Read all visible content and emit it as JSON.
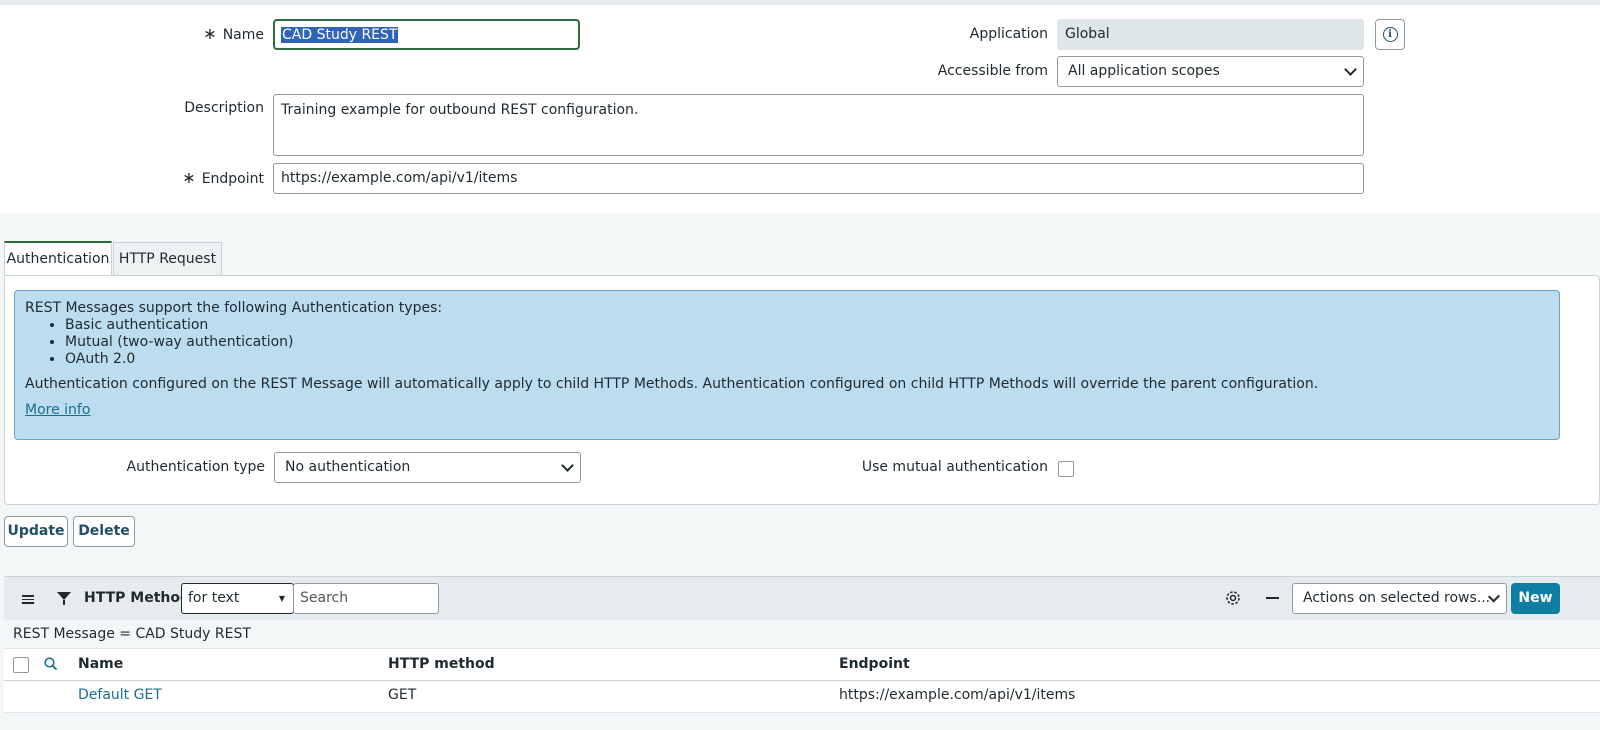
{
  "form": {
    "name_label": "Name",
    "name_value": "CAD Study REST",
    "application_label": "Application",
    "application_value": "Global",
    "accessible_label": "Accessible from",
    "accessible_value": "All application scopes",
    "description_label": "Description",
    "description_value": "Training example for outbound REST configuration.",
    "endpoint_label": "Endpoint",
    "endpoint_value": "https://example.com/api/v1/items",
    "required_mark": "∗",
    "info_glyph": "i"
  },
  "tabs": [
    {
      "label": "Authentication",
      "active": true
    },
    {
      "label": "HTTP Request",
      "active": false
    }
  ],
  "auth": {
    "info_intro": "REST Messages support the following Authentication types:",
    "info_types": [
      "Basic authentication",
      "Mutual (two-way authentication)",
      "OAuth 2.0"
    ],
    "info_note": "Authentication configured on the REST Message will automatically apply to child HTTP Methods. Authentication configured on child HTTP Methods will override the parent configuration.",
    "more_info": "More info",
    "auth_type_label": "Authentication type",
    "auth_type_value": "No authentication",
    "mutual_label": "Use mutual authentication",
    "mutual_checked": false
  },
  "actions": {
    "update": "Update",
    "delete": "Delete"
  },
  "related_list": {
    "title": "HTTP Methods",
    "search_field": "for text",
    "search_placeholder": "Search",
    "actions_select": "Actions on selected rows...",
    "new_button": "New",
    "breadcrumb": "REST Message = CAD Study REST",
    "columns": [
      "Name",
      "HTTP method",
      "Endpoint"
    ],
    "rows": [
      {
        "name": "Default GET",
        "method": "GET",
        "endpoint": "https://example.com/api/v1/items"
      }
    ]
  },
  "colors": {
    "accent_green": "#2e6b3e",
    "info_blue": "#bcdcf0",
    "primary_button": "#0f7ea3",
    "link": "#1a6e8e"
  }
}
